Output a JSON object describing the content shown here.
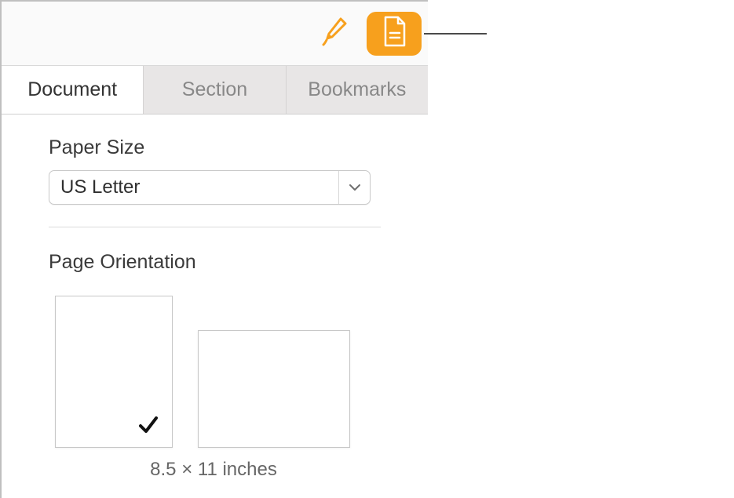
{
  "toolbar": {
    "format_icon": "format-brush-icon",
    "document_icon": "document-page-icon"
  },
  "tabs": {
    "items": [
      {
        "label": "Document",
        "active": true
      },
      {
        "label": "Section",
        "active": false
      },
      {
        "label": "Bookmarks",
        "active": false
      }
    ]
  },
  "paper_size": {
    "label": "Paper Size",
    "selected": "US Letter"
  },
  "page_orientation": {
    "label": "Page Orientation",
    "selected": "portrait",
    "dimensions": "8.5 × 11 inches"
  }
}
